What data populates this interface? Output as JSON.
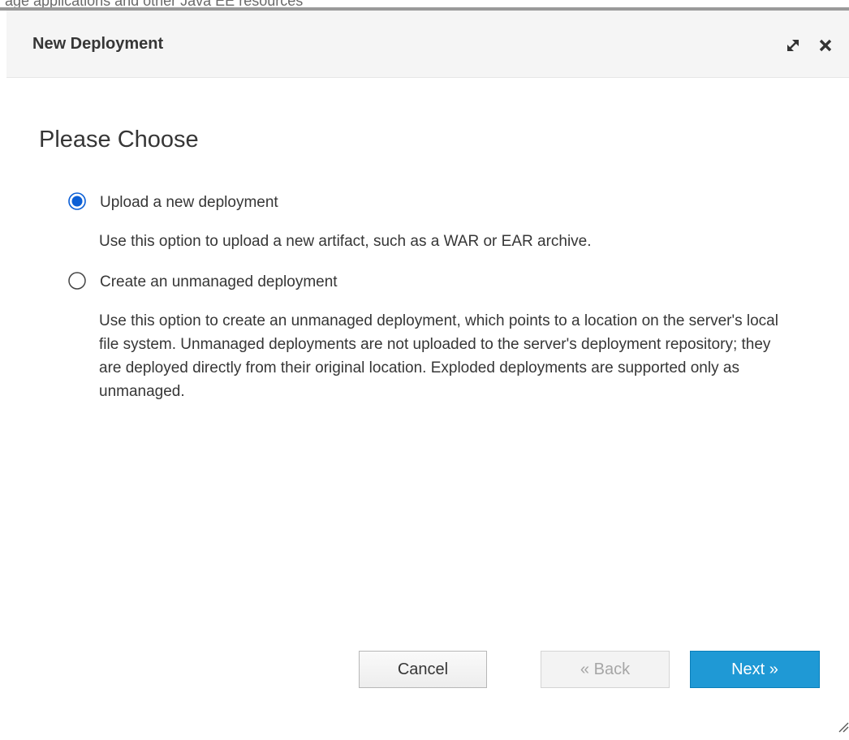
{
  "backdrop": {
    "partial_text": "age applications and other Java EE resources"
  },
  "dialog": {
    "title": "New Deployment",
    "heading": "Please Choose",
    "options": [
      {
        "label": "Upload a new deployment",
        "description": "Use this option to upload a new artifact, such as a WAR or EAR archive.",
        "selected": true
      },
      {
        "label": "Create an unmanaged deployment",
        "description": "Use this option to create an unmanaged deployment, which points to a location on the server's local file system. Unmanaged deployments are not uploaded to the server's deployment repository; they are deployed directly from their original location. Exploded deployments are supported only as unmanaged.",
        "selected": false
      }
    ],
    "buttons": {
      "cancel": "Cancel",
      "back": "« Back",
      "next": "Next »"
    },
    "icons": {
      "maximize": "maximize-icon",
      "close": "close-icon",
      "resize": "resize-grip-icon"
    }
  },
  "colors": {
    "accent": "#1f99d5",
    "radio_selected": "#0b5fd6",
    "text": "#363636",
    "header_bg": "#f5f5f5"
  }
}
